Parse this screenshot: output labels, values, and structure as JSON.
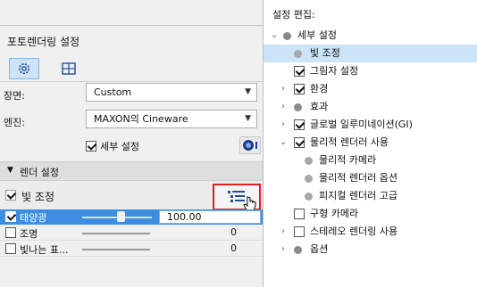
{
  "left_panel": {
    "title": "포토렌더링 설정",
    "scene": {
      "label": "장면:",
      "value": "Custom"
    },
    "engine": {
      "label": "엔진:",
      "value": "MAXON의 Cineware"
    },
    "detail_checkbox": {
      "label": "세부 설정",
      "checked": true
    },
    "render_section": {
      "label": "렌더 설정"
    },
    "light_adjust": {
      "label": "빛 조정",
      "checked": true
    },
    "light_rows": [
      {
        "label": "태양광",
        "value": "100.00",
        "checked": true,
        "level": 0.6
      },
      {
        "label": "조명",
        "value": "0",
        "checked": false,
        "level": 0
      },
      {
        "label": "빛나는 표...",
        "value": "0",
        "checked": false,
        "level": 0
      }
    ]
  },
  "right_panel": {
    "title": "설정 편집:",
    "items": [
      {
        "label": "세부 설정",
        "type": "dot",
        "expander": "open"
      },
      {
        "label": "빛 조정",
        "type": "dot",
        "selected": true
      },
      {
        "label": "그림자 설정",
        "type": "check",
        "checked": true
      },
      {
        "label": "환경",
        "type": "check",
        "checked": true,
        "expander": "closed"
      },
      {
        "label": "효과",
        "type": "dot",
        "expander": "closed"
      },
      {
        "label": "글로벌 일루미네이션(GI)",
        "type": "check",
        "checked": true,
        "expander": "closed"
      },
      {
        "label": "물리적 렌더러 사용",
        "type": "check",
        "checked": true,
        "expander": "open"
      },
      {
        "label": "물리적 카메라",
        "type": "dot"
      },
      {
        "label": "물리적 렌더러 옵션",
        "type": "dot"
      },
      {
        "label": "피지컬 렌더러 고급",
        "type": "dot"
      },
      {
        "label": "구형 카메라",
        "type": "check",
        "checked": false
      },
      {
        "label": "스테레오 렌더링 사용",
        "type": "check",
        "checked": false,
        "expander": "closed"
      },
      {
        "label": "옵션",
        "type": "dot",
        "expander": "closed"
      }
    ]
  },
  "colors": {
    "accent": "#cce4f7",
    "highlight_border": "#e02020",
    "selected_row": "#3d8ee0"
  },
  "icons": [
    "gear-icon",
    "split-view-icon",
    "dropdown-arrow-icon",
    "cineware-logo-icon",
    "collapse-triangle-icon",
    "tree-settings-icon",
    "cursor-pointer-icon"
  ]
}
